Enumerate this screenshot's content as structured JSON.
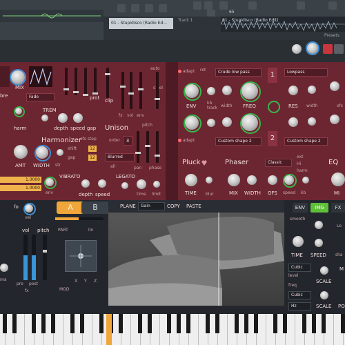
{
  "daw": {
    "clip_name": "01 - Stupidisco (Radio Ed...",
    "track_label": "Track 1",
    "waveform_title": "01 - Stupidisco (Radio Edit)",
    "number_display": "65",
    "presets_label": "Presets"
  },
  "synth": {
    "mix_label": "MIX",
    "fade_option": "Fade",
    "tone_label": "bre",
    "trem_label": "TREM",
    "harm_label": "harm",
    "depth_label": "depth",
    "speed_label": "speed",
    "gap_label": "gap",
    "harmonizer_label": "Harmonizer",
    "ofs_step_label": "ofs step",
    "shift_label": "shift",
    "shift_value": "12",
    "gap2_label": "gap",
    "gap2_value": "12",
    "amt_label": "AMT",
    "width_label": "WIDTH",
    "str_label": "str",
    "vibrato_label": "VIBRATO",
    "env_label": "env",
    "depth2_label": "depth",
    "speed2_label": "speed",
    "value_box_1": "1.0000",
    "value_box_2": "1.0000",
    "prot_label": "prot",
    "clip_label": "clip",
    "auto_label": "auto",
    "s_vel_label": "s vel",
    "fx_label": "fx",
    "vol_label": "vol",
    "env_small_label": "env",
    "pitch_label": "pitch",
    "unison_label": "Unison",
    "order_label": "order",
    "order_value": "3",
    "blurred_option": "Blurred",
    "all_label": "all",
    "pan_label": "pan",
    "phase_label": "phase",
    "legato_label": "LEGATO",
    "time_label": "time",
    "limit_label": "limit",
    "adapt_label_1": "adapt",
    "ret_label": "ret",
    "filter1_option": "Crude low pass",
    "filter2_option": "Lowpass",
    "env_knob_label": "ENV",
    "kb_track_label": "kb track",
    "width2_label": "width",
    "freq_label": "FREQ",
    "res_label": "RES",
    "width3_label": "width",
    "ofs_label": "ofs",
    "slot1_label": "1",
    "slot2_label": "2",
    "adapt_label_2": "adapt",
    "shape1_option": "Custom shape 2",
    "shape2_option": "Custom shape 2",
    "pluck_label": "Pluck",
    "phaser_label": "Phaser",
    "classic_option": "Classic",
    "eq_label": "EQ",
    "time2_label": "TIME",
    "blur_label": "blur",
    "mix2_label": "MIX",
    "width4_label": "WIDTH",
    "ofs2_label": "OFS",
    "speed3_label": "speed",
    "kb_label": "kb",
    "ext_label": "ext",
    "hi_label": "Hi",
    "harm_label2": "harm",
    "mix3_label": "MI"
  },
  "lower": {
    "fo_label": "fo",
    "vel_label": "vel",
    "vol_label": "vol",
    "pitch_label": "pitch",
    "pre_label": "pre",
    "post_label": "post",
    "fx_label": "fx",
    "ma_label": "ma",
    "mod_label": "MOD",
    "x_label": "X",
    "y_label": "Y",
    "z_label": "Z",
    "a_button": "A",
    "b_button": "B",
    "part_label": "PART",
    "lin_label": "lin",
    "plane_label": "PLANE",
    "gain_option": "Gain",
    "copy_button": "COPY",
    "paste_button": "PASTE",
    "env_tab": "ENV",
    "img_tab": "IMG",
    "fx_tab": "FX",
    "smooth_label": "smooth",
    "lo_label": "Lo",
    "time_label": "TIME",
    "speed_label": "SPEED",
    "sha_label": "sha",
    "cubic_option_1": "Cubic",
    "level_label": "level",
    "freq_label": "freq",
    "cubic_option_2": "Cubic",
    "hz_option": "Hz",
    "scale_label_1": "SCALE",
    "scale_label_2": "SCALE",
    "m_label": "M",
    "po_label": "PO"
  },
  "colors": {
    "panel_red": "#6c2631",
    "accent_green": "#3ab54a",
    "accent_orange": "#f0b34c",
    "img_tab_green": "#5fbf3a"
  }
}
